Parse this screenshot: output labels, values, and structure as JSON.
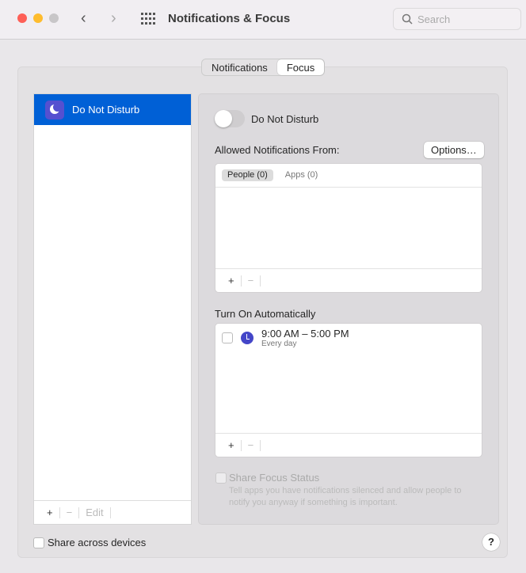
{
  "window": {
    "title": "Notifications & Focus",
    "search_placeholder": "Search"
  },
  "tabs": [
    {
      "label": "Notifications"
    },
    {
      "label": "Focus"
    }
  ],
  "focus_list": {
    "items": [
      {
        "label": "Do Not Disturb"
      }
    ],
    "add": "+",
    "remove": "−",
    "edit": "Edit"
  },
  "detail": {
    "toggle_label": "Do Not Disturb",
    "toggle_on": false,
    "allowed_heading": "Allowed Notifications From:",
    "options_button": "Options…",
    "subtabs": [
      {
        "label": "People (0)"
      },
      {
        "label": "Apps (0)"
      }
    ],
    "add": "+",
    "remove": "−",
    "auto_heading": "Turn On Automatically",
    "schedule": {
      "time": "9:00 AM – 5:00 PM",
      "days": "Every day"
    },
    "share_status_label": "Share Focus Status",
    "share_status_desc": "Tell apps you have notifications silenced and allow people to notify you anyway if something is important."
  },
  "share_devices_label": "Share across devices",
  "help": "?"
}
